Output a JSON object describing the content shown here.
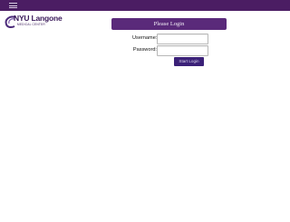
{
  "header": {
    "menu_icon": "hamburger-menu-icon",
    "bar_color": "#4b1d63"
  },
  "logo": {
    "name": "NYU Langone",
    "subtitle": "MEDICAL CENTER"
  },
  "login": {
    "title": "Please Login",
    "username_label": "Username:",
    "username_value": "",
    "password_label": "Password:",
    "password_value": "",
    "submit_label": "Start Login",
    "header_color": "#5a2a7a",
    "button_color": "#3b2178"
  }
}
